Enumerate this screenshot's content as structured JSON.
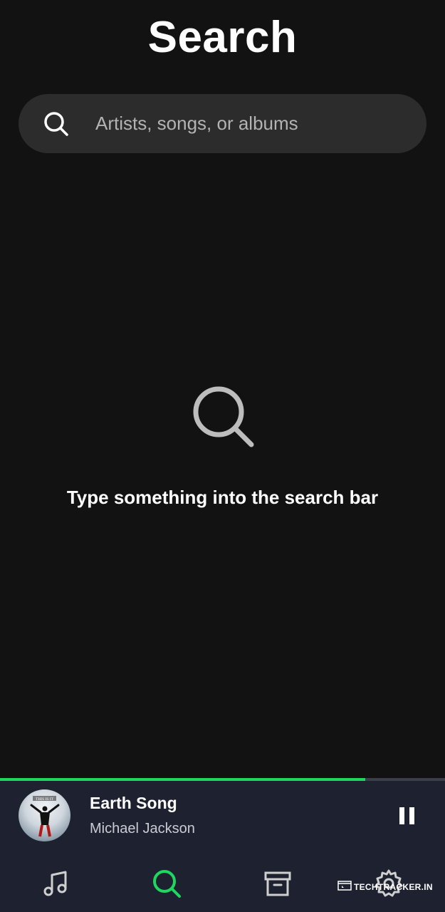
{
  "header": {
    "title": "Search"
  },
  "search": {
    "placeholder": "Artists, songs, or albums",
    "value": "",
    "icon": "search-icon"
  },
  "empty_state": {
    "icon": "search-icon",
    "message": "Type something into the search bar"
  },
  "player": {
    "progress": 0.82,
    "track_title": "Earth Song",
    "artist": "Michael Jackson",
    "album_art_text": "THIS IS IT",
    "control_icon": "pause-icon"
  },
  "bottom_nav": {
    "items": [
      {
        "icon": "music-note-icon",
        "active": false
      },
      {
        "icon": "search-icon",
        "active": true
      },
      {
        "icon": "archive-box-icon",
        "active": false
      },
      {
        "icon": "gear-icon",
        "active": false
      }
    ]
  },
  "watermark": {
    "text": "TECHTRACKER.IN"
  },
  "colors": {
    "background": "#121212",
    "search_bar": "#2c2c2c",
    "player_background": "#1e2230",
    "accent": "#1ed760",
    "icon_inactive": "#cfcfcf"
  }
}
